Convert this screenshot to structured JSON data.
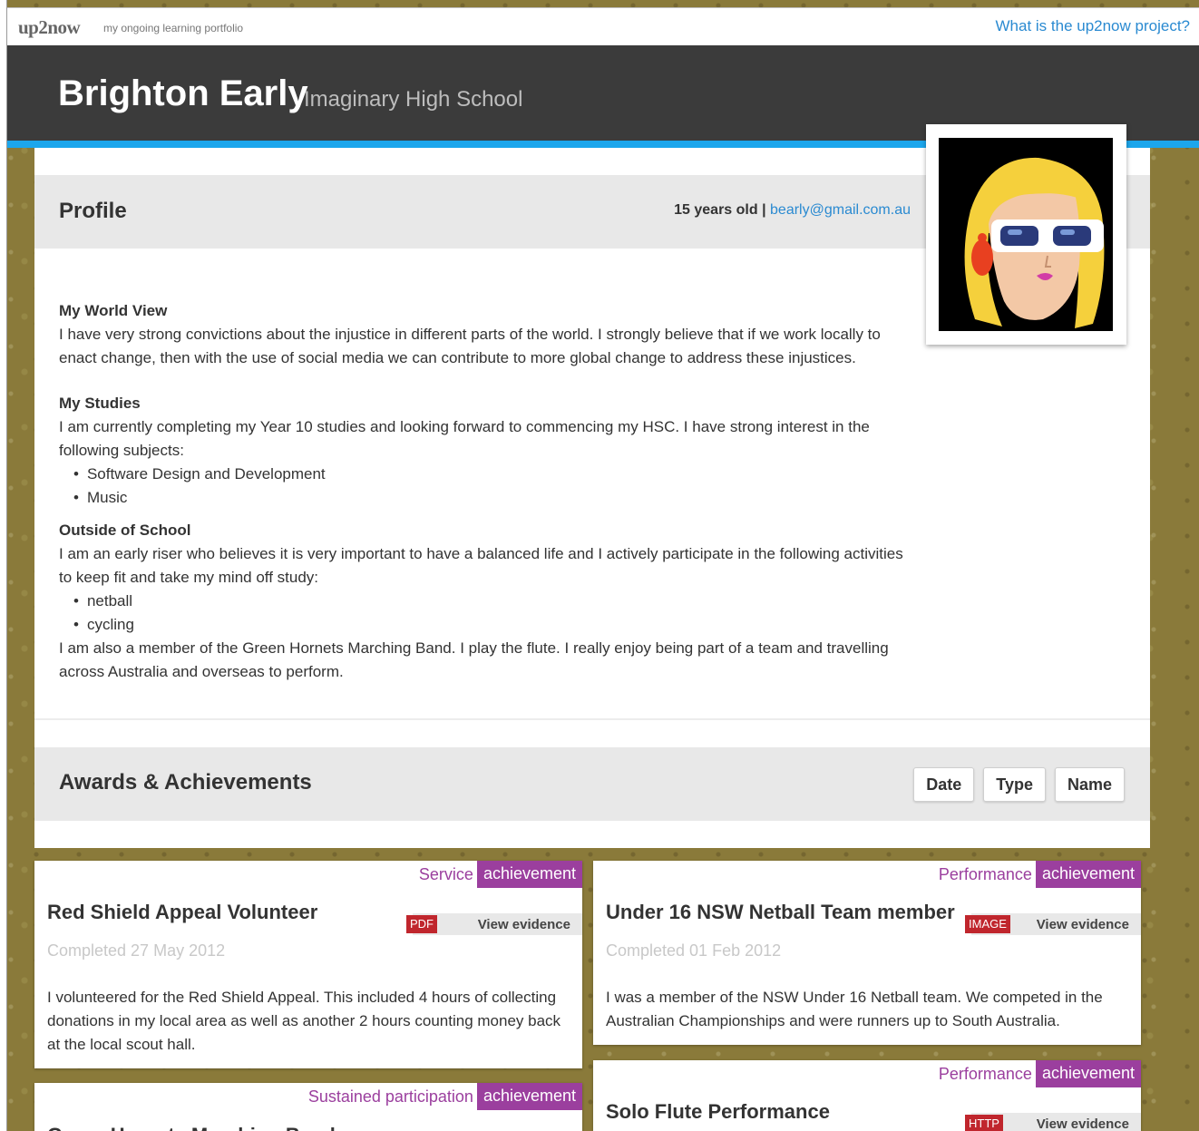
{
  "topbar": {
    "brand": "up2now",
    "tagline": "my ongoing learning portfolio",
    "project_link": "What is the up2now project?"
  },
  "header": {
    "name": "Brighton Early",
    "school": "Imaginary High School"
  },
  "profile": {
    "title": "Profile",
    "age": "15 years old",
    "separator": "|",
    "email": "bearly@gmail.com.au",
    "world_view_heading": "My World View",
    "world_view_text": "I have very strong convictions about the injustice in different parts of the world. I strongly believe that if we work locally to enact change, then with the use of social media we can contribute to more global change to address these injustices.",
    "studies_heading": "My Studies",
    "studies_text": "I am currently completing my Year 10 studies and looking forward to commencing my HSC. I have strong interest in the following subjects:",
    "subjects": [
      "Software Design and Development",
      "Music"
    ],
    "outside_heading": "Outside of School",
    "outside_text": "I am an early riser who believes it is very important to have a balanced life and I actively participate in the following activities to keep fit and take my mind off study:",
    "activities": [
      "netball",
      "cycling"
    ],
    "band_text": "I am also a member of the Green Hornets Marching Band. I play the flute. I really enjoy being part of a team and travelling across Australia and overseas to perform."
  },
  "awards": {
    "title": "Awards & Achievements",
    "sort_buttons": [
      "Date",
      "Type",
      "Name"
    ],
    "cards": [
      {
        "category": "Service",
        "badge": "achievement",
        "title": "Red Shield Appeal Volunteer",
        "file_type": "PDF",
        "evidence_label": "View evidence",
        "completed": "Completed 27 May 2012",
        "description": "I volunteered for the Red Shield Appeal. This included 4 hours of collecting donations in my local area as well as another 2 hours counting money back at the local scout hall."
      },
      {
        "category": "Performance",
        "badge": "achievement",
        "title": "Under 16 NSW Netball Team member",
        "file_type": "IMAGE",
        "evidence_label": "View evidence",
        "completed": "Completed 01 Feb 2012",
        "description": "I was a member of the NSW Under 16 Netball team. We competed in the Australian Championships and were runners up to South Australia."
      },
      {
        "category": "Sustained participation",
        "badge": "achievement",
        "title": "Green Hornets Marching Band"
      },
      {
        "category": "Performance",
        "badge": "achievement",
        "title": "Solo Flute Performance",
        "file_type": "HTTP",
        "evidence_label": "View evidence"
      }
    ]
  },
  "colors": {
    "header_bg": "#3b3b3b",
    "accent_stripe": "#1ca6ec",
    "link": "#2a8ad1",
    "badge": "#9b3f9e",
    "file_type": "#c0262d",
    "section_bg": "#e8e8e8"
  }
}
